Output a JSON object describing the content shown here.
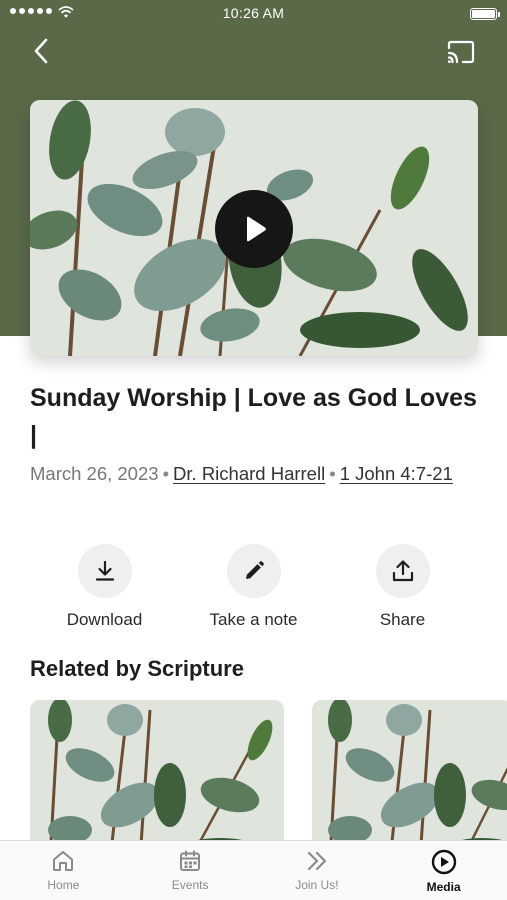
{
  "status_bar": {
    "time": "10:26 AM"
  },
  "header": {
    "back_icon": "chevron-left-icon",
    "cast_icon": "cast-icon"
  },
  "media": {
    "title": "Sunday Worship | Love as God Loves |",
    "date": "March 26, 2023",
    "speaker": "Dr. Richard Harrell",
    "scripture": "1 John 4:7-21"
  },
  "actions": [
    {
      "label": "Download",
      "icon": "download-icon"
    },
    {
      "label": "Take a note",
      "icon": "pencil-icon"
    },
    {
      "label": "Share",
      "icon": "share-icon"
    }
  ],
  "related": {
    "title": "Related by Scripture"
  },
  "tabs": [
    {
      "label": "Home",
      "icon": "home-icon"
    },
    {
      "label": "Events",
      "icon": "calendar-icon"
    },
    {
      "label": "Join Us!",
      "icon": "double-chevron-icon"
    },
    {
      "label": "Media",
      "icon": "play-circle-icon",
      "active": true
    }
  ],
  "colors": {
    "hero": "#5a6a48",
    "play_button": "#161616",
    "action_circle": "#efefef"
  }
}
